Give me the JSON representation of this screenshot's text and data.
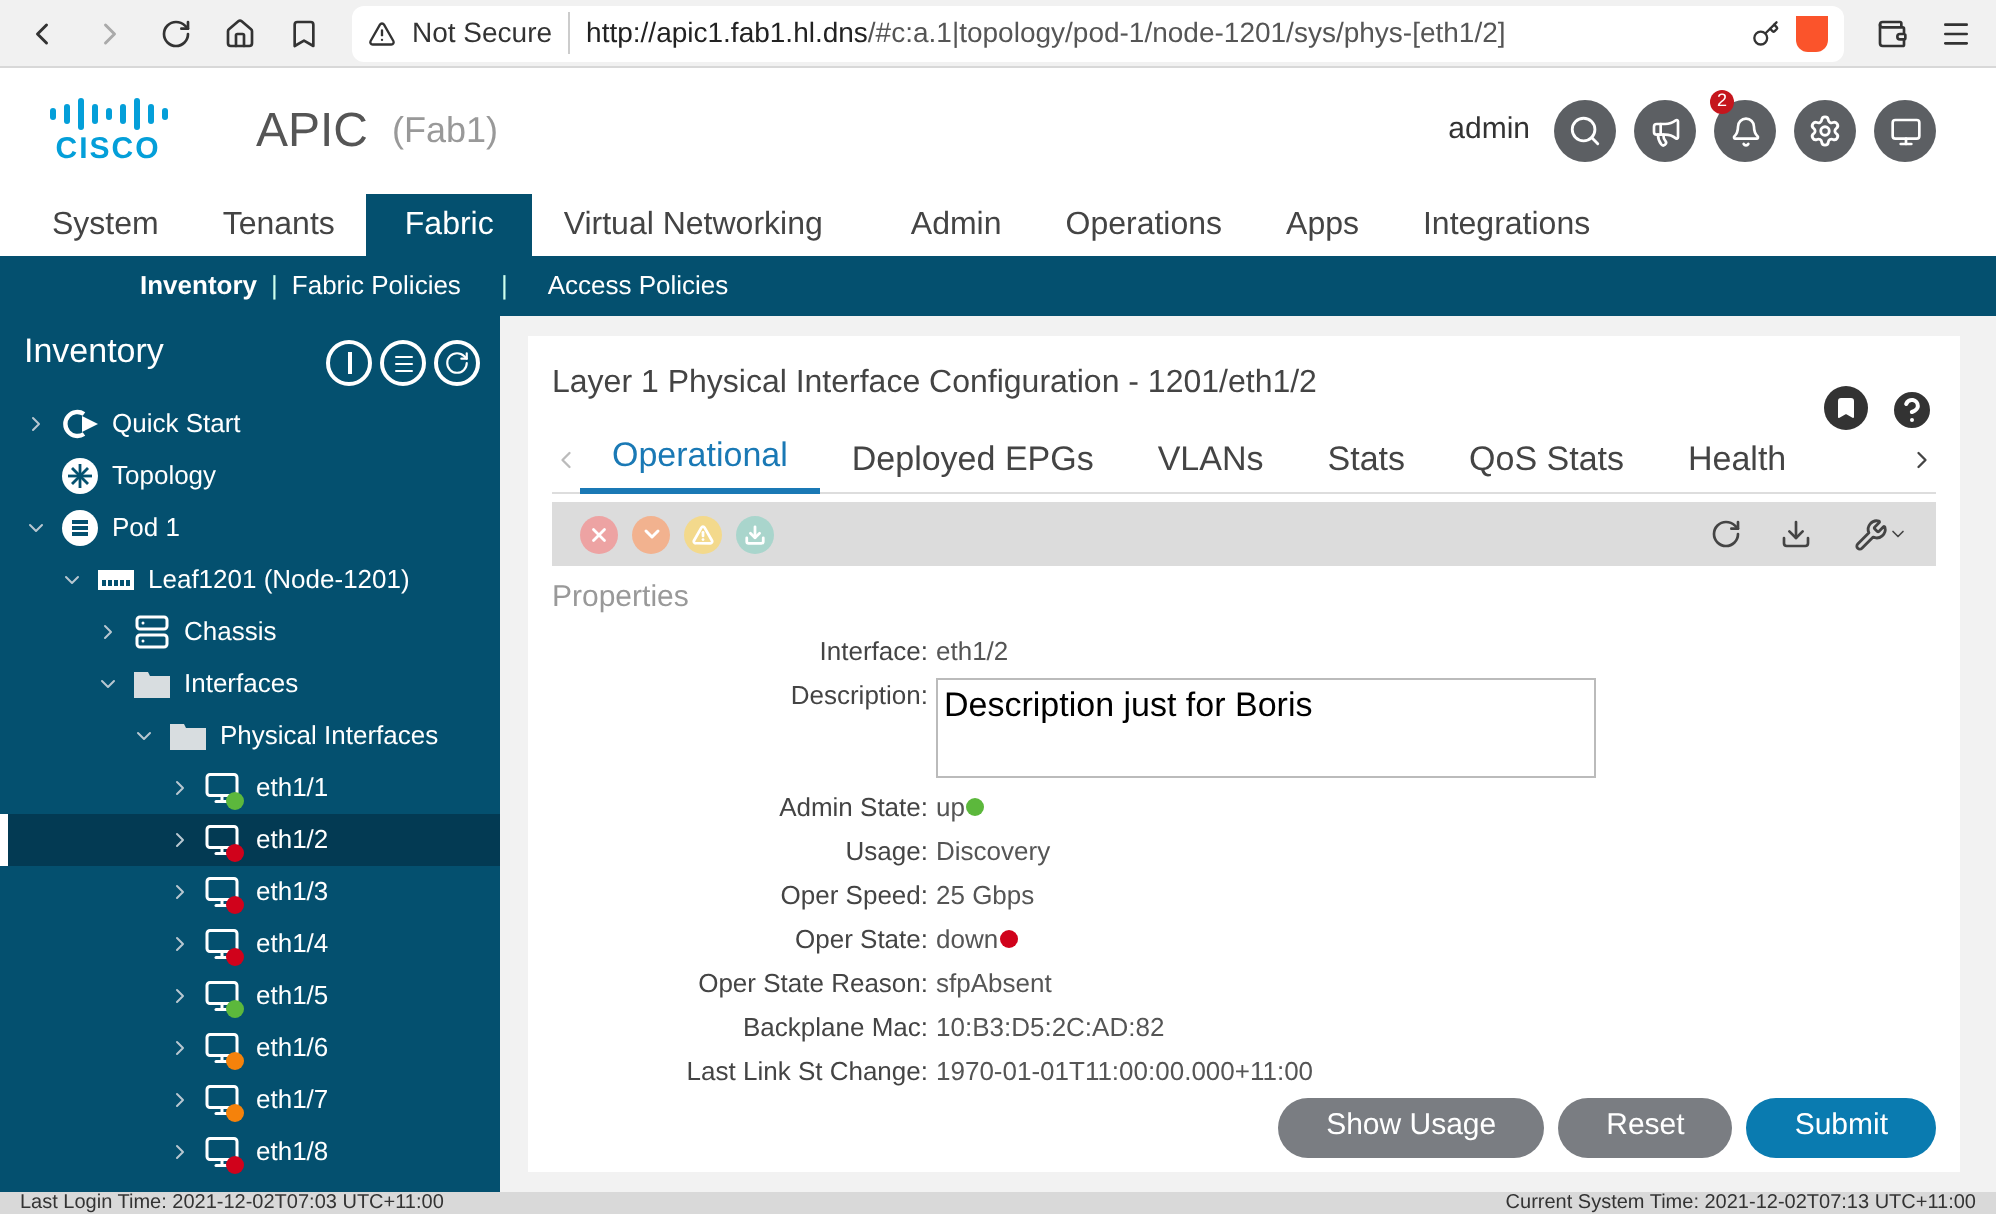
{
  "browser": {
    "security": "Not Secure",
    "url_host": "http://apic1.fab1.hl.dns",
    "url_path": "/#c:a.1|topology/pod-1/node-1201/sys/phys-[eth1/2]"
  },
  "header": {
    "logo_text": "CISCO",
    "app": "APIC",
    "fabric": "(Fab1)",
    "user": "admin",
    "notification_count": "2"
  },
  "nav_tabs": [
    {
      "label": "System",
      "selected": false
    },
    {
      "label": "Tenants",
      "selected": false
    },
    {
      "label": "Fabric",
      "selected": true
    },
    {
      "label": "Virtual Networking",
      "selected": false
    },
    {
      "label": "Admin",
      "selected": false
    },
    {
      "label": "Operations",
      "selected": false
    },
    {
      "label": "Apps",
      "selected": false
    },
    {
      "label": "Integrations",
      "selected": false
    }
  ],
  "sub_nav": [
    {
      "label": "Inventory",
      "selected": true
    },
    {
      "label": "Fabric Policies",
      "selected": false,
      "divider": "|"
    },
    {
      "label": "Access Policies",
      "selected": false,
      "divider": "|"
    }
  ],
  "sidebar": {
    "title": "Inventory",
    "tree": [
      {
        "label": "Quick Start",
        "kind": "quickstart",
        "expandable": true,
        "expanded": false,
        "selected": false
      },
      {
        "label": "Topology",
        "kind": "topology",
        "expandable": false,
        "selected": false
      },
      {
        "label": "Pod 1",
        "kind": "pod",
        "expandable": true,
        "expanded": true,
        "selected": false,
        "children": [
          {
            "label": "Leaf1201 (Node-1201)",
            "kind": "leaf",
            "expandable": true,
            "expanded": true,
            "selected": false,
            "children": [
              {
                "label": "Chassis",
                "kind": "chassis",
                "expandable": true,
                "expanded": false,
                "selected": false
              },
              {
                "label": "Interfaces",
                "kind": "folder",
                "expandable": true,
                "expanded": true,
                "selected": false,
                "children": [
                  {
                    "label": "Physical Interfaces",
                    "kind": "folder",
                    "expandable": true,
                    "expanded": true,
                    "selected": false,
                    "children": [
                      {
                        "label": "eth1/1",
                        "kind": "port",
                        "expandable": true,
                        "expanded": false,
                        "selected": false,
                        "color": "#5cb83c"
                      },
                      {
                        "label": "eth1/2",
                        "kind": "port",
                        "expandable": true,
                        "expanded": false,
                        "selected": true,
                        "color": "#d0021b"
                      },
                      {
                        "label": "eth1/3",
                        "kind": "port",
                        "expandable": true,
                        "expanded": false,
                        "selected": false,
                        "color": "#d0021b"
                      },
                      {
                        "label": "eth1/4",
                        "kind": "port",
                        "expandable": true,
                        "expanded": false,
                        "selected": false,
                        "color": "#d0021b"
                      },
                      {
                        "label": "eth1/5",
                        "kind": "port",
                        "expandable": true,
                        "expanded": false,
                        "selected": false,
                        "color": "#5cb83c"
                      },
                      {
                        "label": "eth1/6",
                        "kind": "port",
                        "expandable": true,
                        "expanded": false,
                        "selected": false,
                        "color": "#f5820b"
                      },
                      {
                        "label": "eth1/7",
                        "kind": "port",
                        "expandable": true,
                        "expanded": false,
                        "selected": false,
                        "color": "#f5820b"
                      },
                      {
                        "label": "eth1/8",
                        "kind": "port",
                        "expandable": true,
                        "expanded": false,
                        "selected": false,
                        "color": "#d0021b"
                      }
                    ]
                  }
                ]
              }
            ]
          }
        ]
      }
    ]
  },
  "panel": {
    "title": "Layer 1 Physical Interface Configuration - 1201/eth1/2",
    "tabs": [
      {
        "label": "Operational",
        "selected": true
      },
      {
        "label": "Deployed EPGs",
        "selected": false
      },
      {
        "label": "VLANs",
        "selected": false
      },
      {
        "label": "Stats",
        "selected": false
      },
      {
        "label": "QoS Stats",
        "selected": false
      },
      {
        "label": "Health",
        "selected": false
      }
    ],
    "section": "Properties",
    "properties": [
      {
        "label": "Interface:",
        "value": "eth1/2",
        "kind": "text"
      },
      {
        "label": "Description:",
        "value": "Description just for Boris",
        "kind": "textarea"
      },
      {
        "label": "Admin State:",
        "value": "up",
        "kind": "status",
        "color": "#5cb83c"
      },
      {
        "label": "Usage:",
        "value": "Discovery",
        "kind": "text"
      },
      {
        "label": "Oper Speed:",
        "value": "25 Gbps",
        "kind": "text"
      },
      {
        "label": "Oper State:",
        "value": "down",
        "kind": "status",
        "color": "#d0021b"
      },
      {
        "label": "Oper State Reason:",
        "value": "sfpAbsent",
        "kind": "text"
      },
      {
        "label": "Backplane Mac:",
        "value": "10:B3:D5:2C:AD:82",
        "kind": "text"
      },
      {
        "label": "Last Link St Change:",
        "value": "1970-01-01T11:00:00.000+11:00",
        "kind": "text"
      }
    ],
    "buttons": [
      {
        "label": "Show Usage",
        "kind": "secondary"
      },
      {
        "label": "Reset",
        "kind": "secondary"
      },
      {
        "label": "Submit",
        "kind": "primary"
      }
    ]
  },
  "status_bar": {
    "left": "Last Login Time: 2021-12-02T07:03 UTC+11:00",
    "right": "Current System Time: 2021-12-02T07:13 UTC+11:00"
  }
}
